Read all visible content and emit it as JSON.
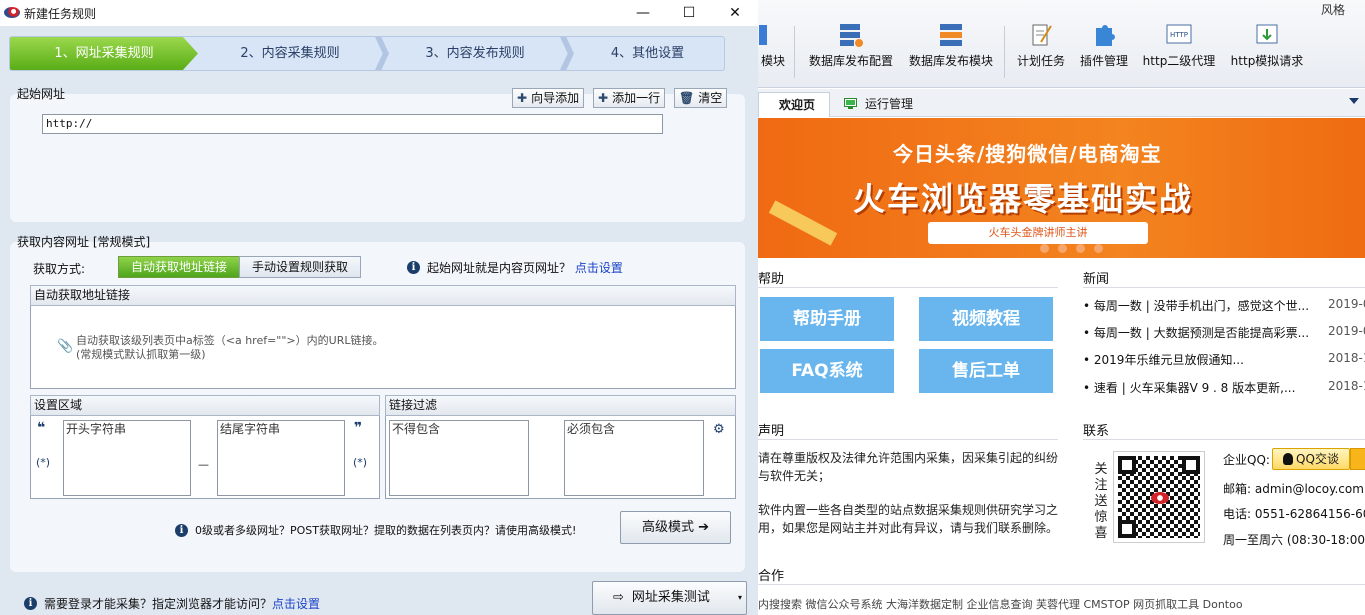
{
  "background": {
    "ribbon": {
      "style_label": "风格",
      "buttons": [
        {
          "label": "模块",
          "icon": "module-icon"
        },
        {
          "label": "数据库发布配置",
          "icon": "db-config-icon"
        },
        {
          "label": "数据库发布模块",
          "icon": "db-module-icon"
        },
        {
          "label": "计划任务",
          "icon": "schedule-icon"
        },
        {
          "label": "插件管理",
          "icon": "plugin-icon"
        },
        {
          "label": "http二级代理",
          "icon": "http-proxy-icon",
          "icon_text": "HTTP"
        },
        {
          "label": "http模拟请求",
          "icon": "http-request-icon"
        }
      ]
    },
    "tabs": [
      {
        "label": "欢迎页"
      },
      {
        "label": "运行管理"
      }
    ],
    "banner": {
      "line1": "今日头条/搜狗微信/电商淘宝",
      "line2": "火车浏览器零基础实战",
      "tag": "火车头金牌讲师主讲"
    },
    "help": {
      "title": "帮助",
      "buttons": [
        "帮助手册",
        "视频教程",
        "FAQ系统",
        "售后工单"
      ]
    },
    "news": {
      "title": "新闻",
      "items": [
        {
          "text": "每周一数 | 没带手机出门，感觉这个世...",
          "date": "2019-0"
        },
        {
          "text": "每周一数 | 大数据预测是否能提高彩票...",
          "date": "2019-0"
        },
        {
          "text": "2019年乐维元旦放假通知...",
          "date": "2018-1"
        },
        {
          "text": "速看 | 火车采集器V 9 . 8 版本更新,...",
          "date": "2018-1"
        }
      ]
    },
    "statement": {
      "title": "声明",
      "lines": [
        "请在尊重版权及法律允许范围内采集，因采集引起的纠纷",
        "与软件无关；",
        "软件内置一些各自类型的站点数据采集规则供研究学习之",
        "用，如果您是网站主并对此有异议，请与我们联系删除。"
      ]
    },
    "contact": {
      "title": "联系",
      "follow_text": "关注送惊喜",
      "qq_label": "企业QQ:",
      "qq_button": "QQ交谈",
      "email": "邮箱: admin@locoy.com",
      "phone": "电话: 0551-62864156-606",
      "hours": "周一至周六 (08:30-18:00)"
    },
    "partners": {
      "title": "合作"
    },
    "footer": "内搜搜索    微信公众号系统    大海洋数据定制    企业信息查询    芙蓉代理    CMSTOP    网页抓取工具    Dontoo"
  },
  "dialog": {
    "title": "新建任务规则",
    "window_controls": {
      "minimize": "—",
      "maximize": "☐",
      "close": "✕"
    },
    "steps": [
      {
        "label": "1、网址采集规则",
        "active": true
      },
      {
        "label": "2、内容采集规则",
        "active": false
      },
      {
        "label": "3、内容发布规则",
        "active": false
      },
      {
        "label": "4、其他设置",
        "active": false
      }
    ],
    "start_url": {
      "title": "起始网址",
      "wizard_add": "向导添加",
      "add_row": "添加一行",
      "clear": "清空",
      "value": "http://"
    },
    "content_url": {
      "title": "获取内容网址 [常规模式]",
      "mode_label": "获取方式:",
      "mode_auto": "自动获取地址链接",
      "mode_manual": "手动设置规则获取",
      "hint": "起始网址就是内容页网址？",
      "hint_link": "点击设置",
      "auto_panel_title": "自动获取地址链接",
      "auto_desc_1": "自动获取该级列表页中a标签（<a href=\"\">）内的URL链接。",
      "auto_desc_2": "(常规模式默认抓取第一级)",
      "area_title": "设置区域",
      "start_placeholder": "开头字符串",
      "end_placeholder": "结尾字符串",
      "any_token": "(*)",
      "dash": "—",
      "filter_title": "链接过滤",
      "exclude_placeholder": "不得包含",
      "include_placeholder": "必须包含",
      "advanced_hint": "0级或者多级网址？POST获取网址？提取的数据在列表页内？请使用高级模式!",
      "advanced_button": "高级模式"
    },
    "bottom": {
      "login_hint": "需要登录才能采集？指定浏览器才能访问？",
      "login_link": "点击设置",
      "test_button": "网址采集测试"
    }
  }
}
